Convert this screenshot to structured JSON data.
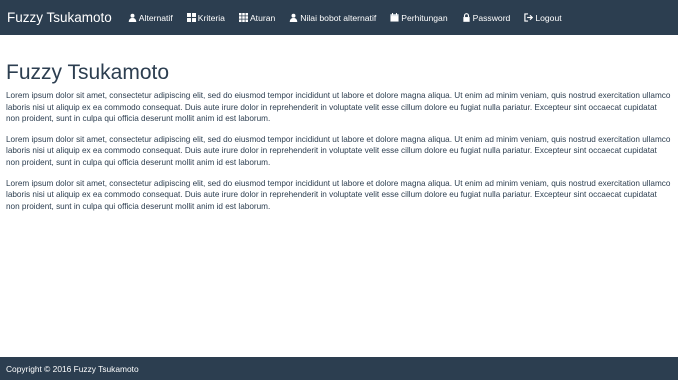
{
  "navbar": {
    "brand": "Fuzzy Tsukamoto",
    "items": [
      {
        "label": "Alternatif",
        "icon": "user-icon"
      },
      {
        "label": "Kriteria",
        "icon": "grid-icon"
      },
      {
        "label": "Aturan",
        "icon": "grid-icon"
      },
      {
        "label": "Nilai bobot alternatif",
        "icon": "user-icon"
      },
      {
        "label": "Perhitungan",
        "icon": "calendar-icon"
      },
      {
        "label": "Password",
        "icon": "lock-icon"
      },
      {
        "label": "Logout",
        "icon": "logout-icon"
      }
    ],
    "background_color": "#2c3e50"
  },
  "main": {
    "title": "Fuzzy Tsukamoto",
    "paragraphs": [
      "Lorem ipsum dolor sit amet, consectetur adipiscing elit, sed do eiusmod tempor incididunt ut labore et dolore magna aliqua. Ut enim ad minim veniam, quis nostrud exercitation ullamco laboris nisi ut aliquip ex ea commodo consequat. Duis aute irure dolor in reprehenderit in voluptate velit esse cillum dolore eu fugiat nulla pariatur. Excepteur sint occaecat cupidatat non proident, sunt in culpa qui officia deserunt mollit anim id est laborum.",
      "Lorem ipsum dolor sit amet, consectetur adipiscing elit, sed do eiusmod tempor incididunt ut labore et dolore magna aliqua. Ut enim ad minim veniam, quis nostrud exercitation ullamco laboris nisi ut aliquip ex ea commodo consequat. Duis aute irure dolor in reprehenderit in voluptate velit esse cillum dolore eu fugiat nulla pariatur. Excepteur sint occaecat cupidatat non proident, sunt in culpa qui officia deserunt mollit anim id est laborum.",
      "Lorem ipsum dolor sit amet, consectetur adipiscing elit, sed do eiusmod tempor incididunt ut labore et dolore magna aliqua. Ut enim ad minim veniam, quis nostrud exercitation ullamco laboris nisi ut aliquip ex ea commodo consequat. Duis aute irure dolor in reprehenderit in voluptate velit esse cillum dolore eu fugiat nulla pariatur. Excepteur sint occaecat cupidatat non proident, sunt in culpa qui officia deserunt mollit anim id est laborum."
    ]
  },
  "footer": {
    "text": "Copyright © 2016 Fuzzy Tsukamoto"
  }
}
